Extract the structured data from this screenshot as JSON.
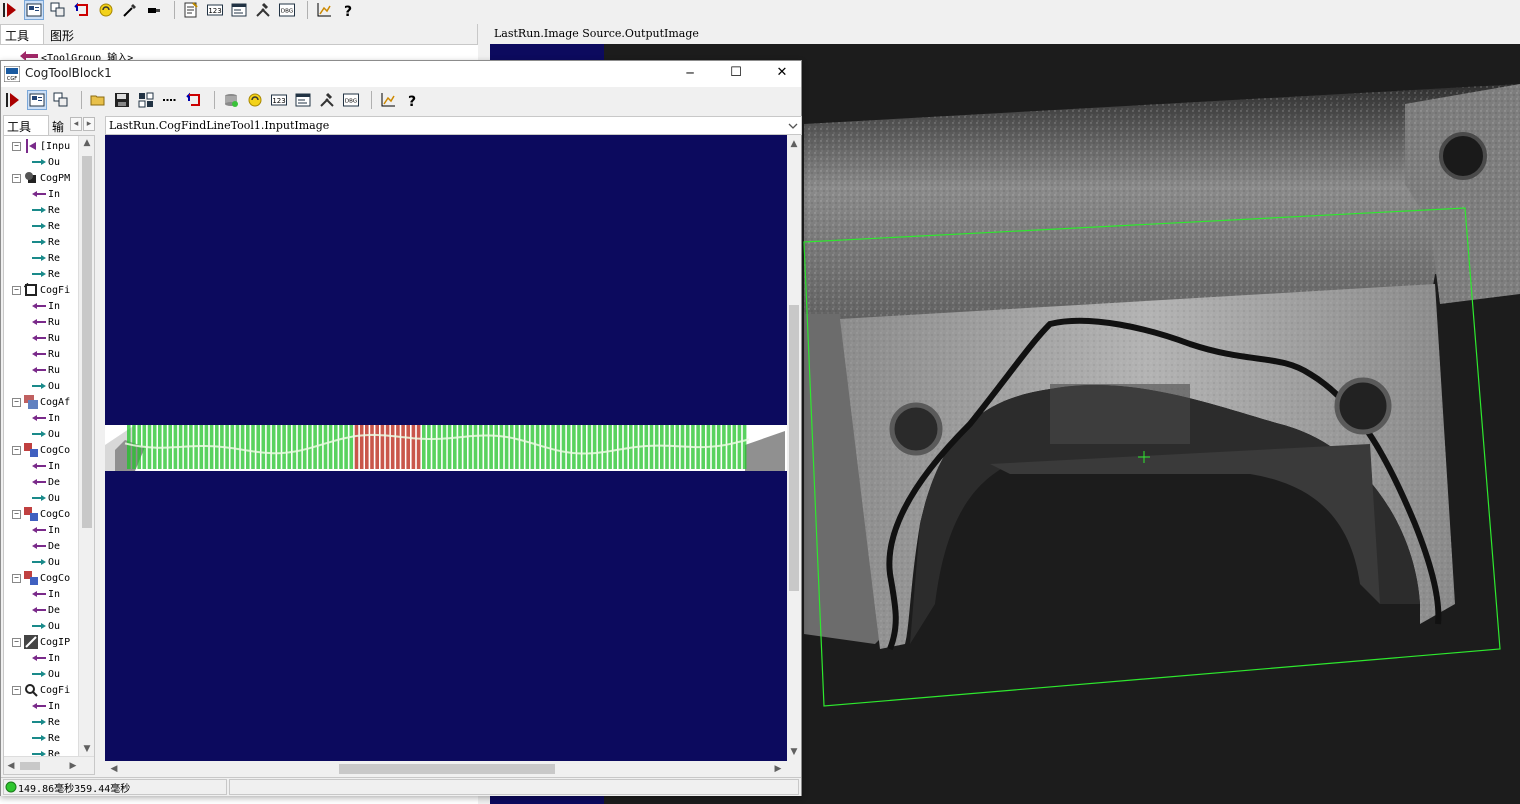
{
  "main_toolbar": {
    "icons": [
      "run-icon",
      "show-image-icon",
      "copy-icon",
      "reset-icon",
      "refresh-icon",
      "wand-icon",
      "terminal-icon",
      "notes-icon",
      "numbers-icon",
      "dialog-icon",
      "tools-icon",
      "dbg-icon",
      "chart-icon",
      "help-icon"
    ],
    "numbers_label": "123",
    "dbg_label": "DBG"
  },
  "left_panel": {
    "tab_tools": "工具",
    "tab_graphics": "图形",
    "group_item": "<ToolGroup 输入>"
  },
  "image_panel": {
    "title": "LastRun.Image Source.OutputImage"
  },
  "dialog": {
    "title": "CogToolBlock1",
    "minimize": "─",
    "maximize": "☐",
    "close": "✕",
    "toolbar_numbers_label": "123",
    "toolbar_dbg_label": "DBG",
    "tab_tools": "工具",
    "tab_input": "输",
    "view_selector": "LastRun.CogFindLineTool1.InputImage",
    "status_text": "149.86毫秒359.44毫秒",
    "tree": [
      {
        "label": "[Inpu",
        "level": 0,
        "type": "inputs"
      },
      {
        "label": "Ou",
        "level": 1,
        "type": "out"
      },
      {
        "label": "CogPM",
        "level": 0,
        "type": "pm"
      },
      {
        "label": "In",
        "level": 1,
        "type": "in"
      },
      {
        "label": "Re",
        "level": 1,
        "type": "out"
      },
      {
        "label": "Re",
        "level": 1,
        "type": "out"
      },
      {
        "label": "Re",
        "level": 1,
        "type": "out"
      },
      {
        "label": "Re",
        "level": 1,
        "type": "out"
      },
      {
        "label": "Re",
        "level": 1,
        "type": "out"
      },
      {
        "label": "CogFi",
        "level": 0,
        "type": "fixture"
      },
      {
        "label": "In",
        "level": 1,
        "type": "in"
      },
      {
        "label": "Ru",
        "level": 1,
        "type": "in"
      },
      {
        "label": "Ru",
        "level": 1,
        "type": "in"
      },
      {
        "label": "Ru",
        "level": 1,
        "type": "in"
      },
      {
        "label": "Ru",
        "level": 1,
        "type": "in"
      },
      {
        "label": "Ou",
        "level": 1,
        "type": "out"
      },
      {
        "label": "CogAf",
        "level": 0,
        "type": "affine"
      },
      {
        "label": "In",
        "level": 1,
        "type": "in"
      },
      {
        "label": "Ou",
        "level": 1,
        "type": "out"
      },
      {
        "label": "CogCo",
        "level": 0,
        "type": "convert"
      },
      {
        "label": "In",
        "level": 1,
        "type": "in"
      },
      {
        "label": "De",
        "level": 1,
        "type": "in"
      },
      {
        "label": "Ou",
        "level": 1,
        "type": "out"
      },
      {
        "label": "CogCo",
        "level": 0,
        "type": "convert"
      },
      {
        "label": "In",
        "level": 1,
        "type": "in"
      },
      {
        "label": "De",
        "level": 1,
        "type": "in"
      },
      {
        "label": "Ou",
        "level": 1,
        "type": "out"
      },
      {
        "label": "CogCo",
        "level": 0,
        "type": "convert"
      },
      {
        "label": "In",
        "level": 1,
        "type": "in"
      },
      {
        "label": "De",
        "level": 1,
        "type": "in"
      },
      {
        "label": "Ou",
        "level": 1,
        "type": "out"
      },
      {
        "label": "CogIP",
        "level": 0,
        "type": "ipone"
      },
      {
        "label": "In",
        "level": 1,
        "type": "in"
      },
      {
        "label": "Ou",
        "level": 1,
        "type": "out"
      },
      {
        "label": "CogFi",
        "level": 0,
        "type": "findline"
      },
      {
        "label": "In",
        "level": 1,
        "type": "in"
      },
      {
        "label": "Re",
        "level": 1,
        "type": "out"
      },
      {
        "label": "Re",
        "level": 1,
        "type": "out"
      },
      {
        "label": "Re",
        "level": 1,
        "type": "out"
      }
    ]
  },
  "colors": {
    "display_bg": "#0c0a5e",
    "caliper_green": "#22c32a",
    "caliper_red": "#c0392b",
    "region_green": "#2ee82e",
    "in_arrow": "#7a2a8a",
    "out_arrow": "#1a8a8a"
  }
}
